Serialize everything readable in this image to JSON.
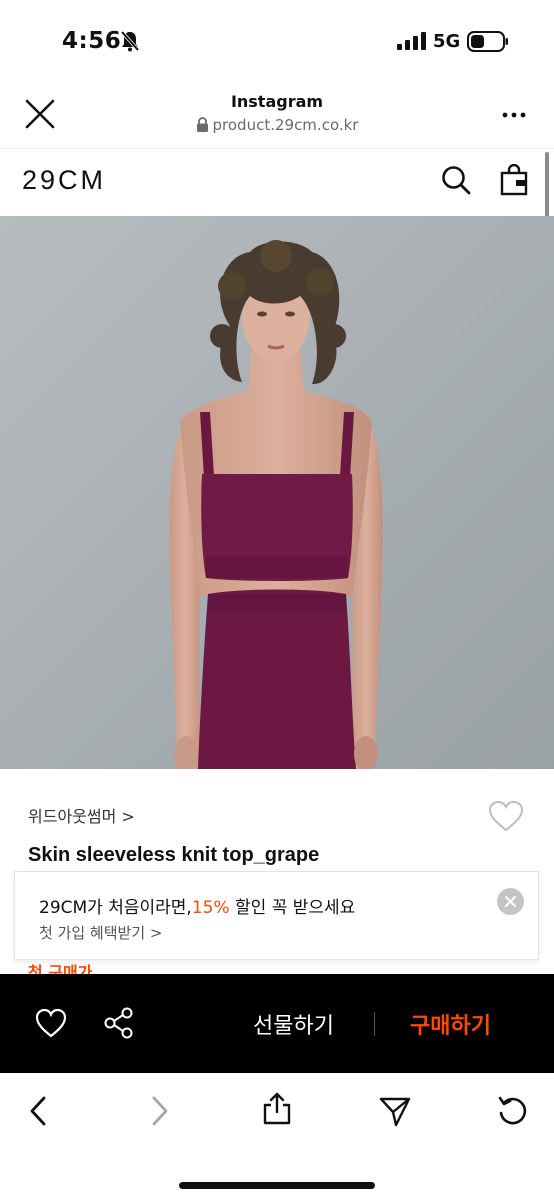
{
  "status_bar": {
    "time": "4:56",
    "network": "5G",
    "icons": [
      "bell-slash-icon",
      "signal-icon",
      "battery-icon"
    ]
  },
  "browser": {
    "title": "Instagram",
    "url": "product.29cm.co.kr",
    "icons": [
      "close-icon",
      "lock-icon",
      "more-icon"
    ]
  },
  "site": {
    "logo": "29CM",
    "icons": [
      "search-icon",
      "shopping-bag-icon"
    ]
  },
  "product": {
    "image_alt": "Model wearing grape sleeveless knit top and knit skirt",
    "brand": "위드아웃썸머 >",
    "title": "Skin sleeveless knit top_grape",
    "wishlist_icon": "heart-outline-icon"
  },
  "promo": {
    "text_before": "29CM가 처음이라면,",
    "highlight": "15%",
    "text_after": " 할인 꼭 받으세요",
    "sub": "첫 가입 혜택받기 >",
    "peek_label": "첫 구매가",
    "accent_color": "#ff4800"
  },
  "actions": {
    "gift_label": "선물하기",
    "buy_label": "구매하기",
    "icons": [
      "heart-icon",
      "share-icon"
    ],
    "buy_color": "#ff4800"
  },
  "toolbar": {
    "icons": [
      "back-arrow-icon",
      "forward-arrow-icon",
      "share-out-icon",
      "send-icon",
      "reload-icon"
    ]
  }
}
